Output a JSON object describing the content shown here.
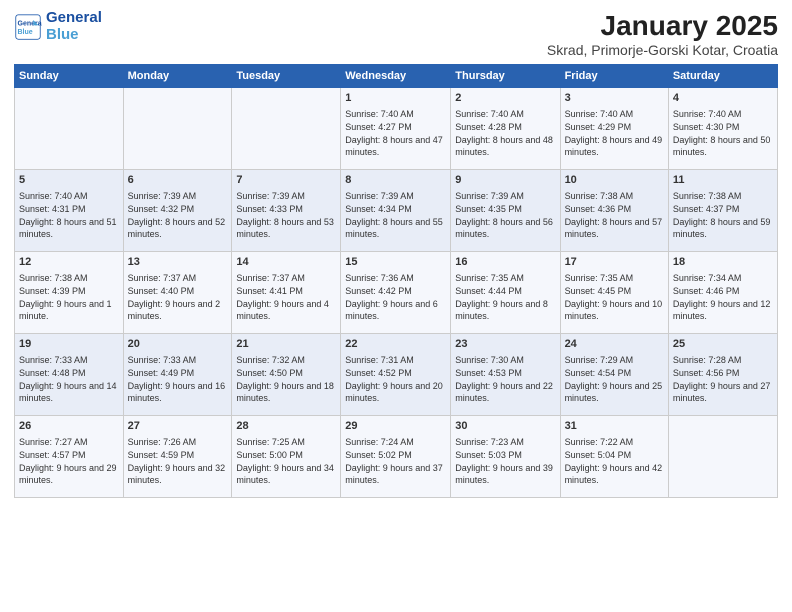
{
  "logo": {
    "line1": "General",
    "line2": "Blue"
  },
  "title": "January 2025",
  "subtitle": "Skrad, Primorje-Gorski Kotar, Croatia",
  "weekdays": [
    "Sunday",
    "Monday",
    "Tuesday",
    "Wednesday",
    "Thursday",
    "Friday",
    "Saturday"
  ],
  "weeks": [
    [
      {
        "day": "",
        "content": ""
      },
      {
        "day": "",
        "content": ""
      },
      {
        "day": "",
        "content": ""
      },
      {
        "day": "1",
        "content": "Sunrise: 7:40 AM\nSunset: 4:27 PM\nDaylight: 8 hours and 47 minutes."
      },
      {
        "day": "2",
        "content": "Sunrise: 7:40 AM\nSunset: 4:28 PM\nDaylight: 8 hours and 48 minutes."
      },
      {
        "day": "3",
        "content": "Sunrise: 7:40 AM\nSunset: 4:29 PM\nDaylight: 8 hours and 49 minutes."
      },
      {
        "day": "4",
        "content": "Sunrise: 7:40 AM\nSunset: 4:30 PM\nDaylight: 8 hours and 50 minutes."
      }
    ],
    [
      {
        "day": "5",
        "content": "Sunrise: 7:40 AM\nSunset: 4:31 PM\nDaylight: 8 hours and 51 minutes."
      },
      {
        "day": "6",
        "content": "Sunrise: 7:39 AM\nSunset: 4:32 PM\nDaylight: 8 hours and 52 minutes."
      },
      {
        "day": "7",
        "content": "Sunrise: 7:39 AM\nSunset: 4:33 PM\nDaylight: 8 hours and 53 minutes."
      },
      {
        "day": "8",
        "content": "Sunrise: 7:39 AM\nSunset: 4:34 PM\nDaylight: 8 hours and 55 minutes."
      },
      {
        "day": "9",
        "content": "Sunrise: 7:39 AM\nSunset: 4:35 PM\nDaylight: 8 hours and 56 minutes."
      },
      {
        "day": "10",
        "content": "Sunrise: 7:38 AM\nSunset: 4:36 PM\nDaylight: 8 hours and 57 minutes."
      },
      {
        "day": "11",
        "content": "Sunrise: 7:38 AM\nSunset: 4:37 PM\nDaylight: 8 hours and 59 minutes."
      }
    ],
    [
      {
        "day": "12",
        "content": "Sunrise: 7:38 AM\nSunset: 4:39 PM\nDaylight: 9 hours and 1 minute."
      },
      {
        "day": "13",
        "content": "Sunrise: 7:37 AM\nSunset: 4:40 PM\nDaylight: 9 hours and 2 minutes."
      },
      {
        "day": "14",
        "content": "Sunrise: 7:37 AM\nSunset: 4:41 PM\nDaylight: 9 hours and 4 minutes."
      },
      {
        "day": "15",
        "content": "Sunrise: 7:36 AM\nSunset: 4:42 PM\nDaylight: 9 hours and 6 minutes."
      },
      {
        "day": "16",
        "content": "Sunrise: 7:35 AM\nSunset: 4:44 PM\nDaylight: 9 hours and 8 minutes."
      },
      {
        "day": "17",
        "content": "Sunrise: 7:35 AM\nSunset: 4:45 PM\nDaylight: 9 hours and 10 minutes."
      },
      {
        "day": "18",
        "content": "Sunrise: 7:34 AM\nSunset: 4:46 PM\nDaylight: 9 hours and 12 minutes."
      }
    ],
    [
      {
        "day": "19",
        "content": "Sunrise: 7:33 AM\nSunset: 4:48 PM\nDaylight: 9 hours and 14 minutes."
      },
      {
        "day": "20",
        "content": "Sunrise: 7:33 AM\nSunset: 4:49 PM\nDaylight: 9 hours and 16 minutes."
      },
      {
        "day": "21",
        "content": "Sunrise: 7:32 AM\nSunset: 4:50 PM\nDaylight: 9 hours and 18 minutes."
      },
      {
        "day": "22",
        "content": "Sunrise: 7:31 AM\nSunset: 4:52 PM\nDaylight: 9 hours and 20 minutes."
      },
      {
        "day": "23",
        "content": "Sunrise: 7:30 AM\nSunset: 4:53 PM\nDaylight: 9 hours and 22 minutes."
      },
      {
        "day": "24",
        "content": "Sunrise: 7:29 AM\nSunset: 4:54 PM\nDaylight: 9 hours and 25 minutes."
      },
      {
        "day": "25",
        "content": "Sunrise: 7:28 AM\nSunset: 4:56 PM\nDaylight: 9 hours and 27 minutes."
      }
    ],
    [
      {
        "day": "26",
        "content": "Sunrise: 7:27 AM\nSunset: 4:57 PM\nDaylight: 9 hours and 29 minutes."
      },
      {
        "day": "27",
        "content": "Sunrise: 7:26 AM\nSunset: 4:59 PM\nDaylight: 9 hours and 32 minutes."
      },
      {
        "day": "28",
        "content": "Sunrise: 7:25 AM\nSunset: 5:00 PM\nDaylight: 9 hours and 34 minutes."
      },
      {
        "day": "29",
        "content": "Sunrise: 7:24 AM\nSunset: 5:02 PM\nDaylight: 9 hours and 37 minutes."
      },
      {
        "day": "30",
        "content": "Sunrise: 7:23 AM\nSunset: 5:03 PM\nDaylight: 9 hours and 39 minutes."
      },
      {
        "day": "31",
        "content": "Sunrise: 7:22 AM\nSunset: 5:04 PM\nDaylight: 9 hours and 42 minutes."
      },
      {
        "day": "",
        "content": ""
      }
    ]
  ]
}
